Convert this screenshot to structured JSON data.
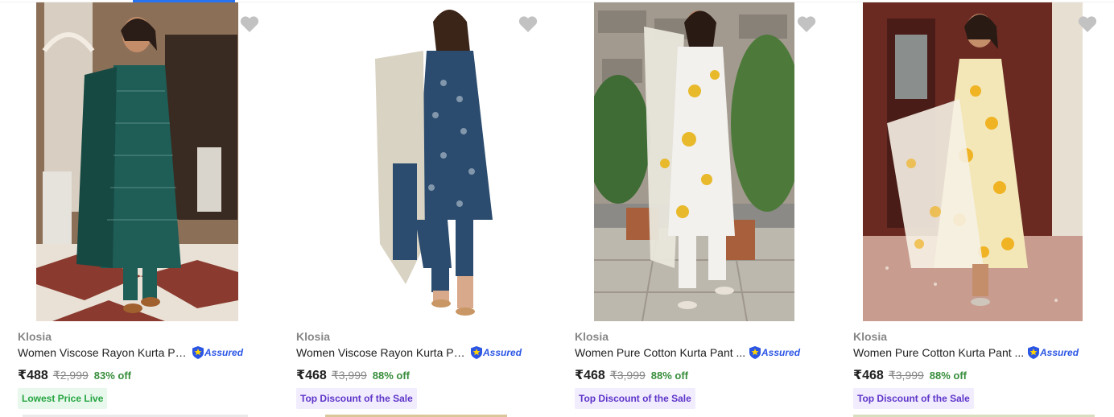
{
  "colors": {
    "brand_accent": "#2874f0",
    "assured_blue": "#2a55e5",
    "discount_green": "#388e3c",
    "badge_green_bg": "#e8f8ec",
    "badge_purple_bg": "#f1ecfe",
    "heart_gray": "#c2c2c2"
  },
  "products": [
    {
      "brand": "Klosia",
      "title": "Women Viscose Rayon Kurta Pa...",
      "assured_label": "Assured",
      "price": "₹488",
      "mrp": "₹2,999",
      "discount": "83% off",
      "badge": "Lowest Price Live",
      "badge_style": "green",
      "image_icon": "kurta-photo-green-printed"
    },
    {
      "brand": "Klosia",
      "title": "Women Viscose Rayon Kurta Pa...",
      "assured_label": "Assured",
      "price": "₹468",
      "mrp": "₹3,999",
      "discount": "88% off",
      "badge": "Top Discount of the Sale",
      "badge_style": "purple",
      "image_icon": "kurta-photo-navy-printed"
    },
    {
      "brand": "Klosia",
      "title": "Women Pure Cotton Kurta Pant ...",
      "assured_label": "Assured",
      "price": "₹468",
      "mrp": "₹3,999",
      "discount": "88% off",
      "badge": "Top Discount of the Sale",
      "badge_style": "purple",
      "image_icon": "kurta-photo-white-yellow-floral"
    },
    {
      "brand": "Klosia",
      "title": "Women Pure Cotton Kurta Pant ...",
      "assured_label": "Assured",
      "price": "₹468",
      "mrp": "₹3,999",
      "discount": "88% off",
      "badge": "Top Discount of the Sale",
      "badge_style": "purple",
      "image_icon": "kurta-photo-yellow-floral-anarkali"
    }
  ]
}
